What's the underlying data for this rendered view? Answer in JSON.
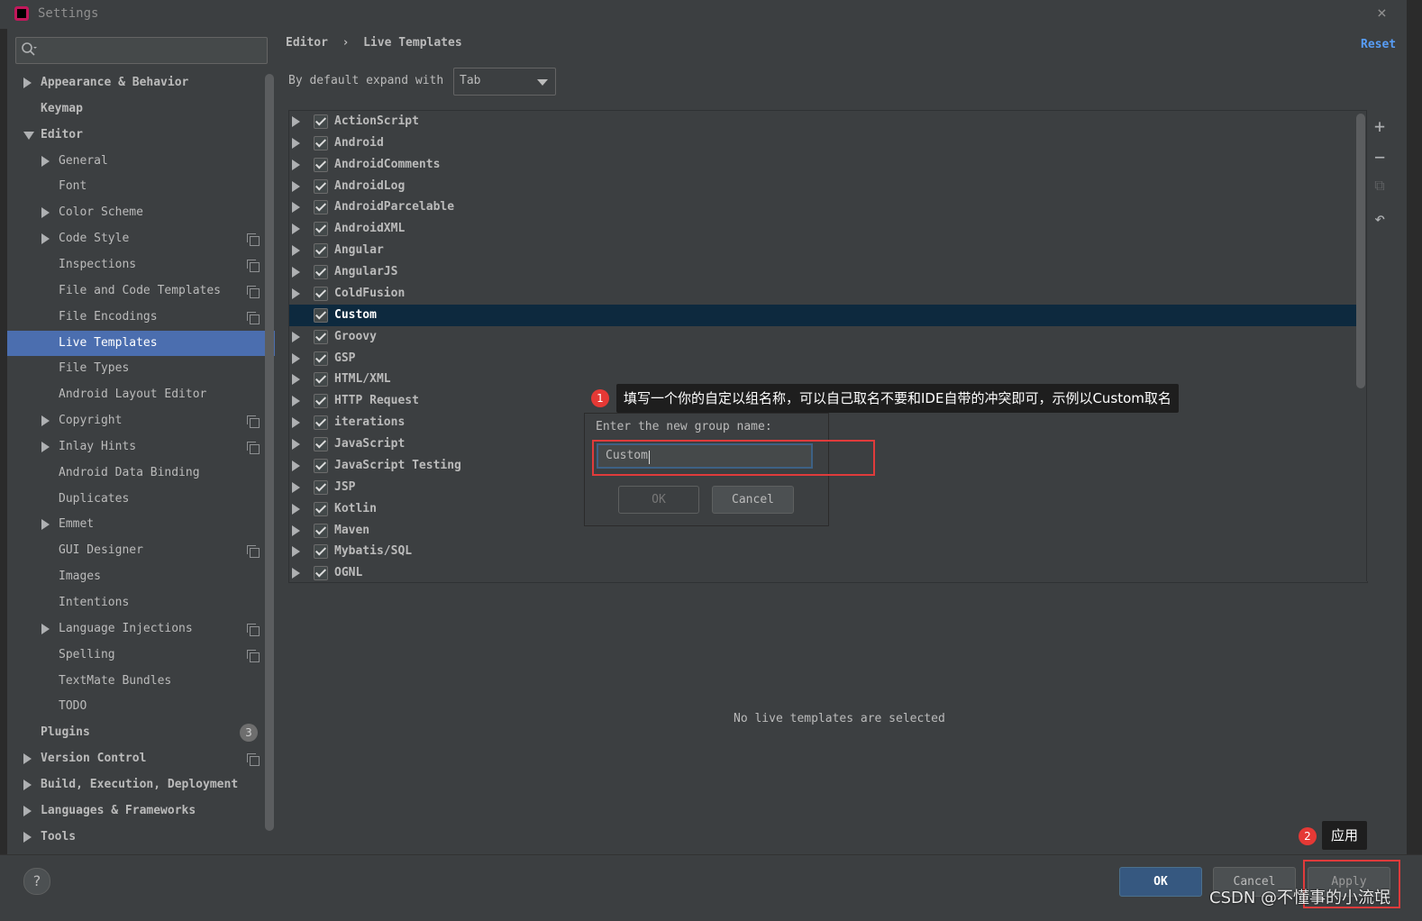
{
  "window": {
    "title": "Settings",
    "close_glyph": "×"
  },
  "search": {
    "icon": "search-icon",
    "placeholder": ""
  },
  "sidebar": {
    "items": [
      {
        "label": "Appearance & Behavior",
        "level": 0,
        "bold": true,
        "arrow": "right"
      },
      {
        "label": "Keymap",
        "level": 0,
        "bold": true,
        "arrow": ""
      },
      {
        "label": "Editor",
        "level": 0,
        "bold": true,
        "arrow": "down"
      },
      {
        "label": "General",
        "level": 1,
        "bold": false,
        "arrow": "right"
      },
      {
        "label": "Font",
        "level": 1,
        "bold": false,
        "arrow": ""
      },
      {
        "label": "Color Scheme",
        "level": 1,
        "bold": false,
        "arrow": "right"
      },
      {
        "label": "Code Style",
        "level": 1,
        "bold": false,
        "arrow": "right",
        "copy": true
      },
      {
        "label": "Inspections",
        "level": 1,
        "bold": false,
        "arrow": "",
        "copy": true
      },
      {
        "label": "File and Code Templates",
        "level": 1,
        "bold": false,
        "arrow": "",
        "copy": true
      },
      {
        "label": "File Encodings",
        "level": 1,
        "bold": false,
        "arrow": "",
        "copy": true
      },
      {
        "label": "Live Templates",
        "level": 1,
        "bold": false,
        "arrow": "",
        "selected": true
      },
      {
        "label": "File Types",
        "level": 1,
        "bold": false,
        "arrow": ""
      },
      {
        "label": "Android Layout Editor",
        "level": 1,
        "bold": false,
        "arrow": ""
      },
      {
        "label": "Copyright",
        "level": 1,
        "bold": false,
        "arrow": "right",
        "copy": true
      },
      {
        "label": "Inlay Hints",
        "level": 1,
        "bold": false,
        "arrow": "right",
        "copy": true
      },
      {
        "label": "Android Data Binding",
        "level": 1,
        "bold": false,
        "arrow": ""
      },
      {
        "label": "Duplicates",
        "level": 1,
        "bold": false,
        "arrow": ""
      },
      {
        "label": "Emmet",
        "level": 1,
        "bold": false,
        "arrow": "right"
      },
      {
        "label": "GUI Designer",
        "level": 1,
        "bold": false,
        "arrow": "",
        "copy": true
      },
      {
        "label": "Images",
        "level": 1,
        "bold": false,
        "arrow": ""
      },
      {
        "label": "Intentions",
        "level": 1,
        "bold": false,
        "arrow": ""
      },
      {
        "label": "Language Injections",
        "level": 1,
        "bold": false,
        "arrow": "right",
        "copy": true
      },
      {
        "label": "Spelling",
        "level": 1,
        "bold": false,
        "arrow": "",
        "copy": true
      },
      {
        "label": "TextMate Bundles",
        "level": 1,
        "bold": false,
        "arrow": ""
      },
      {
        "label": "TODO",
        "level": 1,
        "bold": false,
        "arrow": ""
      },
      {
        "label": "Plugins",
        "level": 0,
        "bold": true,
        "arrow": "",
        "badge": "3"
      },
      {
        "label": "Version Control",
        "level": 0,
        "bold": true,
        "arrow": "right",
        "copy": true
      },
      {
        "label": "Build, Execution, Deployment",
        "level": 0,
        "bold": true,
        "arrow": "right"
      },
      {
        "label": "Languages & Frameworks",
        "level": 0,
        "bold": true,
        "arrow": "right"
      },
      {
        "label": "Tools",
        "level": 0,
        "bold": true,
        "arrow": "right"
      }
    ]
  },
  "header": {
    "breadcrumb": "Editor  ›  Live Templates",
    "reset": "Reset",
    "expand_label": "By default expand with",
    "expand_value": "Tab"
  },
  "toolbar": {
    "add": "+",
    "remove": "−",
    "copy": "⧉",
    "revert": "↶"
  },
  "groups": [
    {
      "name": "ActionScript"
    },
    {
      "name": "Android"
    },
    {
      "name": "AndroidComments"
    },
    {
      "name": "AndroidLog"
    },
    {
      "name": "AndroidParcelable"
    },
    {
      "name": "AndroidXML"
    },
    {
      "name": "Angular"
    },
    {
      "name": "AngularJS"
    },
    {
      "name": "ColdFusion"
    },
    {
      "name": "Custom",
      "highlighted": true,
      "no_arrow": true
    },
    {
      "name": "Groovy"
    },
    {
      "name": "GSP"
    },
    {
      "name": "HTML/XML"
    },
    {
      "name": "HTTP Request"
    },
    {
      "name": "iterations"
    },
    {
      "name": "JavaScript"
    },
    {
      "name": "JavaScript Testing"
    },
    {
      "name": "JSP"
    },
    {
      "name": "Kotlin"
    },
    {
      "name": "Maven"
    },
    {
      "name": "Mybatis/SQL"
    },
    {
      "name": "OGNL"
    }
  ],
  "empty_message": "No live templates are selected",
  "dialog": {
    "label": "Enter the new group name:",
    "value": "Custom",
    "ok": "OK",
    "cancel": "Cancel"
  },
  "annotations": {
    "one_num": "1",
    "one_text": "填写一个你的自定以组名称，可以自己取名不要和IDE自带的冲突即可，示例以Custom取名",
    "two_num": "2",
    "two_text": "应用",
    "accent": "#e03b3b"
  },
  "footer": {
    "help": "?",
    "ok": "OK",
    "cancel": "Cancel",
    "apply": "Apply"
  },
  "watermark": "CSDN @不懂事的小流氓"
}
